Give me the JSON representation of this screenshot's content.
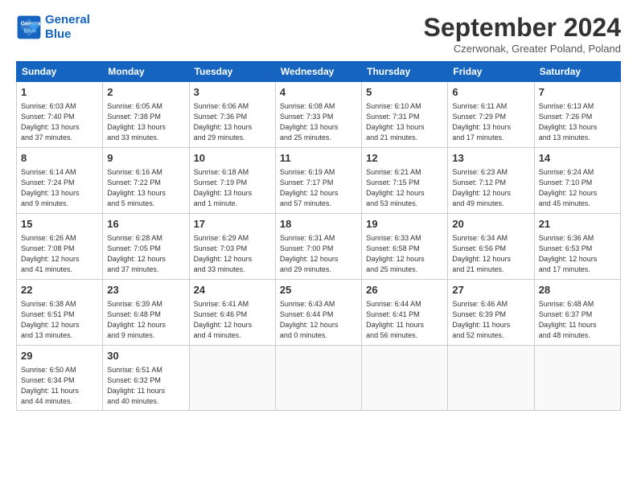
{
  "header": {
    "logo_line1": "General",
    "logo_line2": "Blue",
    "month_title": "September 2024",
    "subtitle": "Czerwonak, Greater Poland, Poland"
  },
  "days_of_week": [
    "Sunday",
    "Monday",
    "Tuesday",
    "Wednesday",
    "Thursday",
    "Friday",
    "Saturday"
  ],
  "weeks": [
    [
      {
        "day": "1",
        "info": "Sunrise: 6:03 AM\nSunset: 7:40 PM\nDaylight: 13 hours\nand 37 minutes."
      },
      {
        "day": "2",
        "info": "Sunrise: 6:05 AM\nSunset: 7:38 PM\nDaylight: 13 hours\nand 33 minutes."
      },
      {
        "day": "3",
        "info": "Sunrise: 6:06 AM\nSunset: 7:36 PM\nDaylight: 13 hours\nand 29 minutes."
      },
      {
        "day": "4",
        "info": "Sunrise: 6:08 AM\nSunset: 7:33 PM\nDaylight: 13 hours\nand 25 minutes."
      },
      {
        "day": "5",
        "info": "Sunrise: 6:10 AM\nSunset: 7:31 PM\nDaylight: 13 hours\nand 21 minutes."
      },
      {
        "day": "6",
        "info": "Sunrise: 6:11 AM\nSunset: 7:29 PM\nDaylight: 13 hours\nand 17 minutes."
      },
      {
        "day": "7",
        "info": "Sunrise: 6:13 AM\nSunset: 7:26 PM\nDaylight: 13 hours\nand 13 minutes."
      }
    ],
    [
      {
        "day": "8",
        "info": "Sunrise: 6:14 AM\nSunset: 7:24 PM\nDaylight: 13 hours\nand 9 minutes."
      },
      {
        "day": "9",
        "info": "Sunrise: 6:16 AM\nSunset: 7:22 PM\nDaylight: 13 hours\nand 5 minutes."
      },
      {
        "day": "10",
        "info": "Sunrise: 6:18 AM\nSunset: 7:19 PM\nDaylight: 13 hours\nand 1 minute."
      },
      {
        "day": "11",
        "info": "Sunrise: 6:19 AM\nSunset: 7:17 PM\nDaylight: 12 hours\nand 57 minutes."
      },
      {
        "day": "12",
        "info": "Sunrise: 6:21 AM\nSunset: 7:15 PM\nDaylight: 12 hours\nand 53 minutes."
      },
      {
        "day": "13",
        "info": "Sunrise: 6:23 AM\nSunset: 7:12 PM\nDaylight: 12 hours\nand 49 minutes."
      },
      {
        "day": "14",
        "info": "Sunrise: 6:24 AM\nSunset: 7:10 PM\nDaylight: 12 hours\nand 45 minutes."
      }
    ],
    [
      {
        "day": "15",
        "info": "Sunrise: 6:26 AM\nSunset: 7:08 PM\nDaylight: 12 hours\nand 41 minutes."
      },
      {
        "day": "16",
        "info": "Sunrise: 6:28 AM\nSunset: 7:05 PM\nDaylight: 12 hours\nand 37 minutes."
      },
      {
        "day": "17",
        "info": "Sunrise: 6:29 AM\nSunset: 7:03 PM\nDaylight: 12 hours\nand 33 minutes."
      },
      {
        "day": "18",
        "info": "Sunrise: 6:31 AM\nSunset: 7:00 PM\nDaylight: 12 hours\nand 29 minutes."
      },
      {
        "day": "19",
        "info": "Sunrise: 6:33 AM\nSunset: 6:58 PM\nDaylight: 12 hours\nand 25 minutes."
      },
      {
        "day": "20",
        "info": "Sunrise: 6:34 AM\nSunset: 6:56 PM\nDaylight: 12 hours\nand 21 minutes."
      },
      {
        "day": "21",
        "info": "Sunrise: 6:36 AM\nSunset: 6:53 PM\nDaylight: 12 hours\nand 17 minutes."
      }
    ],
    [
      {
        "day": "22",
        "info": "Sunrise: 6:38 AM\nSunset: 6:51 PM\nDaylight: 12 hours\nand 13 minutes."
      },
      {
        "day": "23",
        "info": "Sunrise: 6:39 AM\nSunset: 6:48 PM\nDaylight: 12 hours\nand 9 minutes."
      },
      {
        "day": "24",
        "info": "Sunrise: 6:41 AM\nSunset: 6:46 PM\nDaylight: 12 hours\nand 4 minutes."
      },
      {
        "day": "25",
        "info": "Sunrise: 6:43 AM\nSunset: 6:44 PM\nDaylight: 12 hours\nand 0 minutes."
      },
      {
        "day": "26",
        "info": "Sunrise: 6:44 AM\nSunset: 6:41 PM\nDaylight: 11 hours\nand 56 minutes."
      },
      {
        "day": "27",
        "info": "Sunrise: 6:46 AM\nSunset: 6:39 PM\nDaylight: 11 hours\nand 52 minutes."
      },
      {
        "day": "28",
        "info": "Sunrise: 6:48 AM\nSunset: 6:37 PM\nDaylight: 11 hours\nand 48 minutes."
      }
    ],
    [
      {
        "day": "29",
        "info": "Sunrise: 6:50 AM\nSunset: 6:34 PM\nDaylight: 11 hours\nand 44 minutes."
      },
      {
        "day": "30",
        "info": "Sunrise: 6:51 AM\nSunset: 6:32 PM\nDaylight: 11 hours\nand 40 minutes."
      },
      {
        "day": "",
        "info": ""
      },
      {
        "day": "",
        "info": ""
      },
      {
        "day": "",
        "info": ""
      },
      {
        "day": "",
        "info": ""
      },
      {
        "day": "",
        "info": ""
      }
    ]
  ]
}
